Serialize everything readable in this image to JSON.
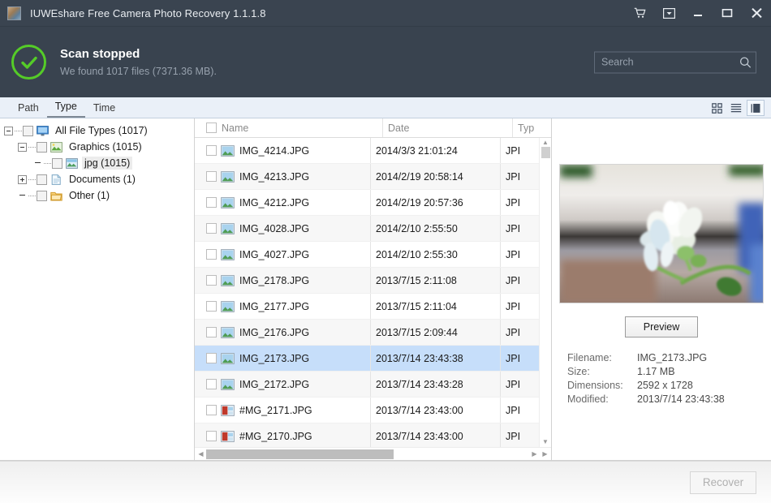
{
  "window": {
    "title": "IUWEshare Free Camera Photo Recovery 1.1.1.8",
    "app_icon": "photo-app-icon",
    "controls": [
      {
        "name": "cart-icon",
        "label": "Buy"
      },
      {
        "name": "dropdown-icon",
        "label": "Menu"
      },
      {
        "name": "minimize-icon",
        "label": "Minimize"
      },
      {
        "name": "maximize-icon",
        "label": "Maximize"
      },
      {
        "name": "close-icon",
        "label": "Close"
      }
    ]
  },
  "status": {
    "icon": "check-circle-icon",
    "title": "Scan stopped",
    "subtitle": "We found 1017 files (7371.36 MB).",
    "accent_color": "#55cc28",
    "band_color": "#39434f"
  },
  "search": {
    "placeholder": "Search",
    "value": "",
    "icon": "search-icon"
  },
  "tabs": [
    {
      "label": "Path",
      "active": false
    },
    {
      "label": "Type",
      "active": true
    },
    {
      "label": "Time",
      "active": false
    }
  ],
  "view_modes": [
    {
      "name": "grid-view-icon",
      "active": false
    },
    {
      "name": "list-view-icon",
      "active": false
    },
    {
      "name": "detail-view-icon",
      "active": true
    }
  ],
  "tree": {
    "nodes": [
      {
        "label": "All File Types (1017)",
        "depth": 0,
        "expander": "minus",
        "icon": "monitor-icon",
        "selected": false
      },
      {
        "label": "Graphics (1015)",
        "depth": 1,
        "expander": "minus",
        "icon": "image-icon",
        "selected": false
      },
      {
        "label": "jpg (1015)",
        "depth": 2,
        "expander": "none",
        "icon": "image-icon",
        "selected": true
      },
      {
        "label": "Documents (1)",
        "depth": 1,
        "expander": "plus",
        "icon": "document-icon",
        "selected": false
      },
      {
        "label": "Other (1)",
        "depth": 1,
        "expander": "none",
        "icon": "folder-icon",
        "selected": false
      }
    ]
  },
  "file_list": {
    "columns": [
      {
        "key": "name",
        "label": "Name"
      },
      {
        "key": "date",
        "label": "Date"
      },
      {
        "key": "type",
        "label": "Typ"
      }
    ],
    "header_checkbox_checked": false,
    "rows": [
      {
        "name": "IMG_4214.JPG",
        "date": "2014/3/3 21:01:24",
        "type": "JPI",
        "icon": "image-file-icon",
        "selected": false,
        "checked": false
      },
      {
        "name": "IMG_4213.JPG",
        "date": "2014/2/19 20:58:14",
        "type": "JPI",
        "icon": "image-file-icon",
        "selected": false,
        "checked": false
      },
      {
        "name": "IMG_4212.JPG",
        "date": "2014/2/19 20:57:36",
        "type": "JPI",
        "icon": "image-file-icon",
        "selected": false,
        "checked": false
      },
      {
        "name": "IMG_4028.JPG",
        "date": "2014/2/10 2:55:50",
        "type": "JPI",
        "icon": "image-file-icon",
        "selected": false,
        "checked": false
      },
      {
        "name": "IMG_4027.JPG",
        "date": "2014/2/10 2:55:30",
        "type": "JPI",
        "icon": "image-file-icon",
        "selected": false,
        "checked": false
      },
      {
        "name": "IMG_2178.JPG",
        "date": "2013/7/15 2:11:08",
        "type": "JPI",
        "icon": "image-file-icon",
        "selected": false,
        "checked": false
      },
      {
        "name": "IMG_2177.JPG",
        "date": "2013/7/15 2:11:04",
        "type": "JPI",
        "icon": "image-file-icon",
        "selected": false,
        "checked": false
      },
      {
        "name": "IMG_2176.JPG",
        "date": "2013/7/15 2:09:44",
        "type": "JPI",
        "icon": "image-file-icon",
        "selected": false,
        "checked": false
      },
      {
        "name": "IMG_2173.JPG",
        "date": "2013/7/14 23:43:38",
        "type": "JPI",
        "icon": "image-file-icon",
        "selected": true,
        "checked": false
      },
      {
        "name": "IMG_2172.JPG",
        "date": "2013/7/14 23:43:28",
        "type": "JPI",
        "icon": "image-file-icon",
        "selected": false,
        "checked": false
      },
      {
        "name": "#MG_2171.JPG",
        "date": "2013/7/14 23:43:00",
        "type": "JPI",
        "icon": "damaged-file-icon",
        "selected": false,
        "checked": false
      },
      {
        "name": "#MG_2170.JPG",
        "date": "2013/7/14 23:43:00",
        "type": "JPI",
        "icon": "damaged-file-icon",
        "selected": false,
        "checked": false
      }
    ],
    "selection_color": "#c6defa"
  },
  "preview": {
    "image_alt": "white jasmine flower on green stem, blurred background",
    "button_label": "Preview",
    "fields": [
      {
        "key": "Filename:",
        "value": "IMG_2173.JPG"
      },
      {
        "key": "Size:",
        "value": "1.17 MB"
      },
      {
        "key": "Dimensions:",
        "value": "2592 x 1728"
      },
      {
        "key": "Modified:",
        "value": "2013/7/14 23:43:38"
      }
    ]
  },
  "footer": {
    "recover_label": "Recover",
    "recover_enabled": false
  }
}
